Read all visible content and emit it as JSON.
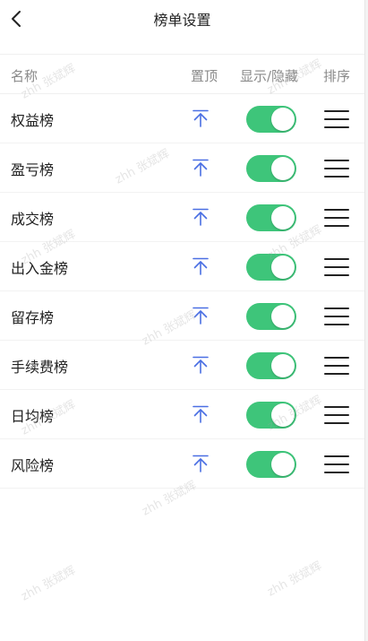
{
  "nav": {
    "title": "榜单设置",
    "back_icon": "chevron-left-icon"
  },
  "columns": {
    "name": "名称",
    "pin": "置顶",
    "visibility": "显示/隐藏",
    "sort": "排序"
  },
  "rows": [
    {
      "name": "权益榜",
      "visible": true
    },
    {
      "name": "盈亏榜",
      "visible": true
    },
    {
      "name": "成交榜",
      "visible": true
    },
    {
      "name": "出入金榜",
      "visible": true
    },
    {
      "name": "留存榜",
      "visible": true
    },
    {
      "name": "手续费榜",
      "visible": true
    },
    {
      "name": "日均榜",
      "visible": true
    },
    {
      "name": "风险榜",
      "visible": true
    }
  ],
  "watermark": "zhh 张斌辉",
  "colors": {
    "toggle_on": "#3ec57a",
    "pin_icon": "#4a6fe3",
    "header_text": "#8a8a8a"
  }
}
